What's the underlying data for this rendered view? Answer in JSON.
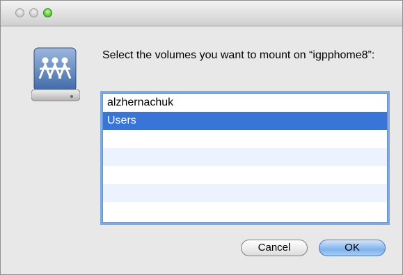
{
  "window": {
    "controls": [
      "close-button",
      "minimize-button",
      "zoom-button"
    ]
  },
  "dialog": {
    "icon": "shared-network-drive-icon",
    "prompt": "Select the volumes you want to mount on “igpphome8”:"
  },
  "volumes": [
    {
      "label": "alzhernachuk",
      "selected": false
    },
    {
      "label": "Users",
      "selected": true
    },
    {
      "label": "",
      "selected": false
    },
    {
      "label": "",
      "selected": false
    },
    {
      "label": "",
      "selected": false
    },
    {
      "label": "",
      "selected": false
    },
    {
      "label": "",
      "selected": false
    }
  ],
  "buttons": {
    "cancel": "Cancel",
    "ok": "OK"
  },
  "colors": {
    "selection": "#3875d7",
    "alt_row": "#edf3fe",
    "focus_ring": "#7eaae3"
  }
}
